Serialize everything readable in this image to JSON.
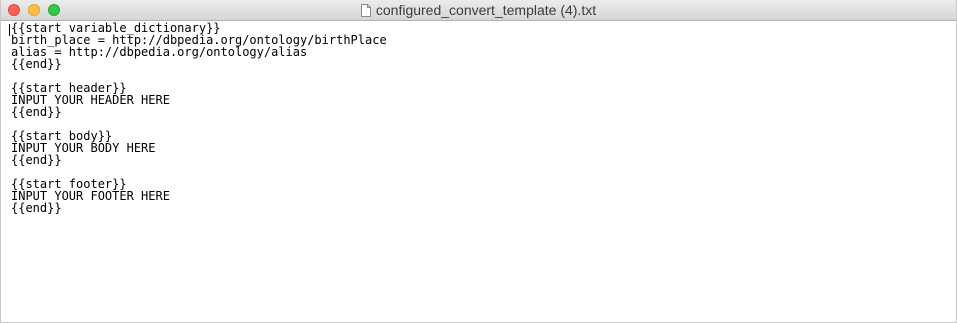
{
  "window": {
    "title": "configured_convert_template (4).txt",
    "title_icon": "document-icon"
  },
  "editor": {
    "lines": [
      "{{start variable_dictionary}}",
      "birth_place = http://dbpedia.org/ontology/birthPlace",
      "alias = http://dbpedia.org/ontology/alias",
      "{{end}}",
      "",
      "{{start header}}",
      "INPUT YOUR HEADER HERE",
      "{{end}}",
      "",
      "{{start body}}",
      "INPUT YOUR BODY HERE",
      "{{end}}",
      "",
      "{{start footer}}",
      "INPUT YOUR FOOTER HERE",
      "{{end}}"
    ]
  }
}
